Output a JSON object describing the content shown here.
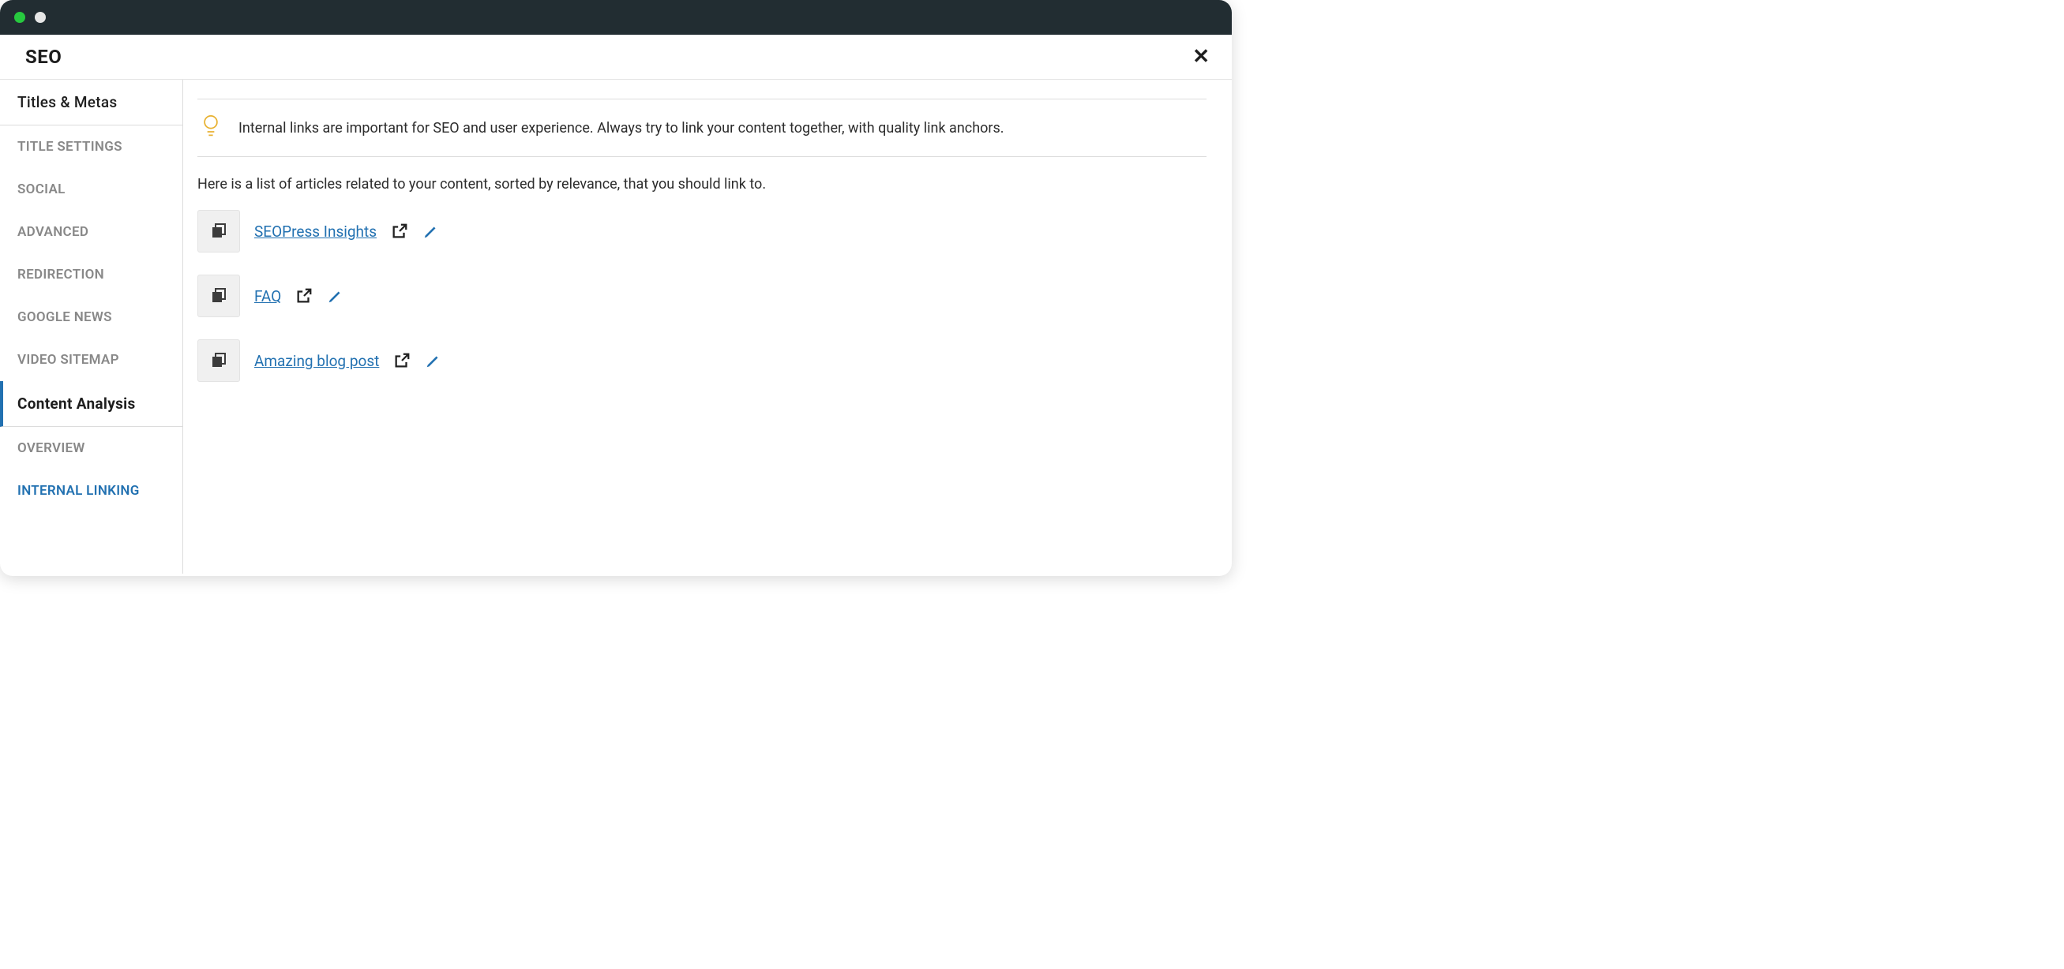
{
  "header": {
    "title": "SEO"
  },
  "sidebar": {
    "items": [
      {
        "label": "Titles & Metas",
        "kind": "primary"
      },
      {
        "label": "TITLE SETTINGS",
        "kind": "sub"
      },
      {
        "label": "SOCIAL",
        "kind": "sub"
      },
      {
        "label": "ADVANCED",
        "kind": "sub"
      },
      {
        "label": "REDIRECTION",
        "kind": "sub"
      },
      {
        "label": "GOOGLE NEWS",
        "kind": "sub"
      },
      {
        "label": "VIDEO SITEMAP",
        "kind": "sub"
      },
      {
        "label": "Content Analysis",
        "kind": "section-active"
      },
      {
        "label": "OVERVIEW",
        "kind": "sub"
      },
      {
        "label": "INTERNAL LINKING",
        "kind": "sub blue"
      }
    ]
  },
  "main": {
    "tip": "Internal links are important for SEO and user experience. Always try to link your content together, with quality link anchors.",
    "intro": "Here is a list of articles related to your content, sorted by relevance, that you should link to.",
    "links": [
      {
        "title": "SEOPress Insights"
      },
      {
        "title": "FAQ"
      },
      {
        "title": "Amazing blog post"
      }
    ]
  }
}
